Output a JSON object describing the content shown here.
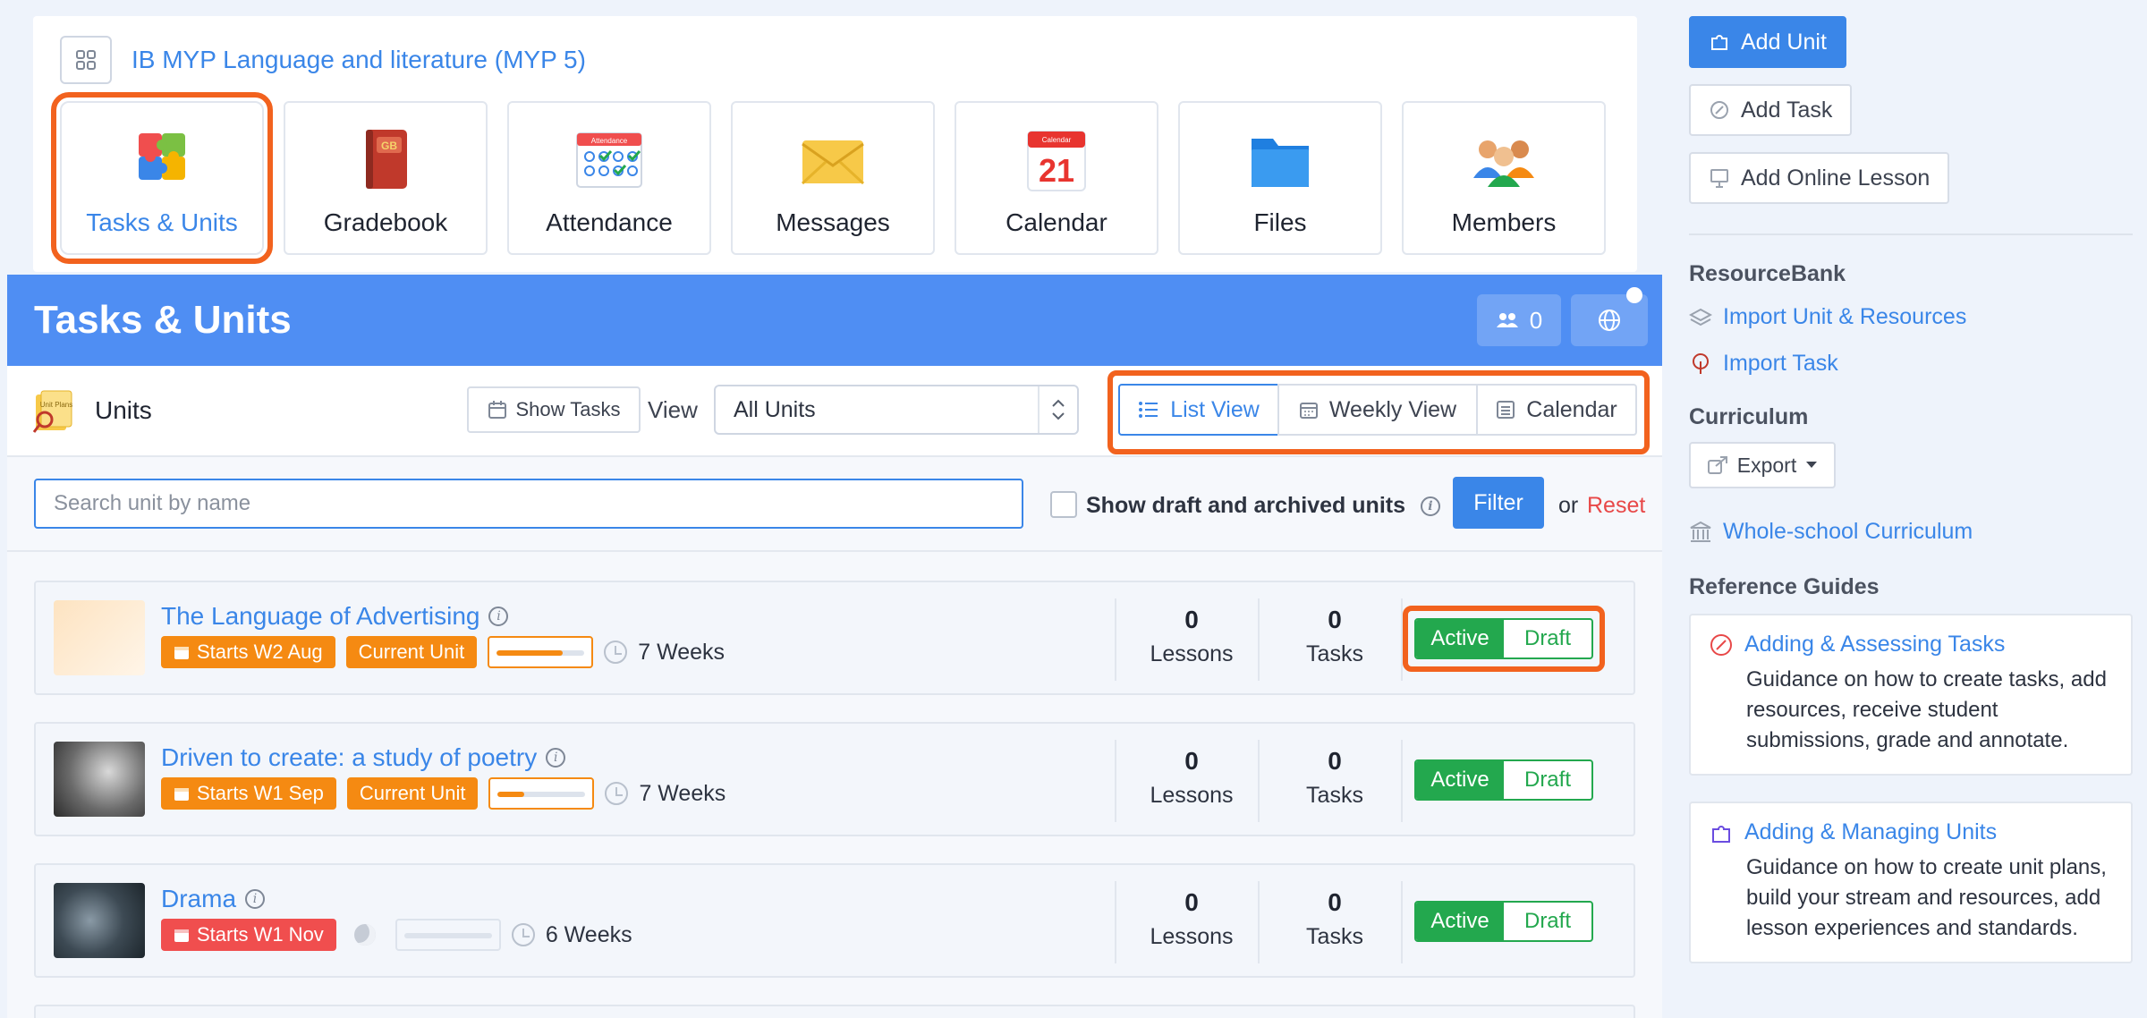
{
  "course": {
    "title": "IB MYP Language and literature (MYP 5)"
  },
  "apps": [
    {
      "label": "Tasks & Units",
      "icon": "puzzle-icon"
    },
    {
      "label": "Gradebook",
      "icon": "gradebook-icon",
      "badge": "GB"
    },
    {
      "label": "Attendance",
      "icon": "attendance-icon",
      "badge": "Attendance"
    },
    {
      "label": "Messages",
      "icon": "envelope-icon"
    },
    {
      "label": "Calendar",
      "icon": "calendar-icon",
      "badge": "Calendar",
      "day": "21"
    },
    {
      "label": "Files",
      "icon": "folder-icon"
    },
    {
      "label": "Members",
      "icon": "people-icon"
    }
  ],
  "header": {
    "title": "Tasks & Units",
    "members_count": "0"
  },
  "toolbar": {
    "units_label": "Units",
    "units_icon_text": "Unit Plans",
    "show_tasks_label": "Show Tasks",
    "view_label": "View",
    "view_selected": "All Units",
    "list_view_label": "List View",
    "weekly_view_label": "Weekly View",
    "calendar_label": "Calendar"
  },
  "search": {
    "placeholder": "Search unit by name",
    "draft_label": "Show draft and archived units",
    "info": "i",
    "filter_label": "Filter",
    "or_label": "or",
    "reset_label": "Reset"
  },
  "units": [
    {
      "title": "The Language of Advertising",
      "starts": "Starts W2 Aug",
      "current": "Current Unit",
      "progress": 0.75,
      "weeks": "7 Weeks",
      "lessons": "0",
      "lessons_label": "Lessons",
      "tasks": "0",
      "tasks_label": "Tasks",
      "active_label": "Active",
      "draft_label": "Draft"
    },
    {
      "title": "Driven to create: a study of poetry",
      "starts": "Starts W1 Sep",
      "current": "Current Unit",
      "progress": 0.3,
      "weeks": "7 Weeks",
      "lessons": "0",
      "lessons_label": "Lessons",
      "tasks": "0",
      "tasks_label": "Tasks",
      "active_label": "Active",
      "draft_label": "Draft"
    },
    {
      "title": "Drama",
      "starts": "Starts W1 Nov",
      "progress": 0,
      "weeks": "6 Weeks",
      "lessons": "0",
      "lessons_label": "Lessons",
      "tasks": "0",
      "tasks_label": "Tasks",
      "active_label": "Active",
      "draft_label": "Draft"
    }
  ],
  "sidebar": {
    "add_unit": "Add Unit",
    "add_task": "Add Task",
    "add_online_lesson": "Add Online Lesson",
    "resourcebank_heading": "ResourceBank",
    "import_unit": "Import Unit & Resources",
    "import_task": "Import Task",
    "curriculum_heading": "Curriculum",
    "export_label": "Export",
    "whole_school": "Whole-school Curriculum",
    "guides_heading": "Reference Guides",
    "guides": [
      {
        "title": "Adding & Assessing Tasks",
        "text": "Guidance on how to create tasks, add resources, receive student submissions, grade and annotate."
      },
      {
        "title": "Adding & Managing Units",
        "text": "Guidance on how to create unit plans, build your stream and resources, add lesson experiences and standards."
      }
    ]
  },
  "colors": {
    "primary": "#3a86e8",
    "header": "#4f8ef3",
    "highlight": "#f2621e",
    "active_green": "#23a84e",
    "badge_orange": "#f58a12",
    "badge_red": "#f04e4e"
  }
}
